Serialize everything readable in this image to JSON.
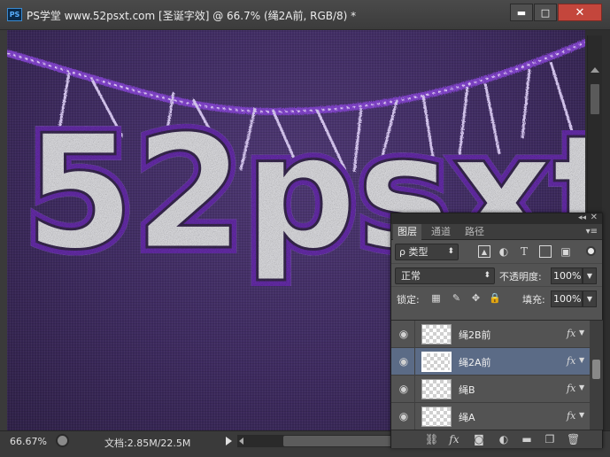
{
  "window": {
    "app_icon": "PS",
    "title": "PS学堂 www.52psxt.com [圣诞字效] @ 66.7% (绳2A前, RGB/8) *",
    "min_glyph": "▬",
    "max_glyph": "□",
    "close_glyph": "✕"
  },
  "canvas": {
    "text": "52psxt",
    "background_color": "#3e2b60",
    "rope_color": "#a06ad8"
  },
  "statusbar": {
    "zoom": "66.67%",
    "doc_info": "文档:2.85M/22.5M"
  },
  "layers_panel": {
    "collapse_glyph": "◂◂",
    "close_glyph": "✕",
    "tabs": [
      "图层",
      "通道",
      "路径"
    ],
    "active_tab": 0,
    "menu_glyph": "▾≡",
    "filter_kind": "ρ 类型",
    "filter_icons": [
      "image-filter-icon",
      "adjustment-filter-icon",
      "type-filter-icon",
      "shape-filter-icon",
      "smart-object-filter-icon"
    ],
    "blend_mode": "正常",
    "opacity_label": "不透明度:",
    "opacity_value": "100%",
    "lock_label": "锁定:",
    "fill_label": "填充:",
    "fill_value": "100%",
    "layers": [
      {
        "name": "绳2B前",
        "visible": true,
        "fx": "fx",
        "selected": false
      },
      {
        "name": "绳2A前",
        "visible": true,
        "fx": "fx",
        "selected": true
      },
      {
        "name": "绳B",
        "visible": true,
        "fx": "fx",
        "selected": false
      },
      {
        "name": "绳A",
        "visible": true,
        "fx": "fx",
        "selected": false
      }
    ]
  }
}
